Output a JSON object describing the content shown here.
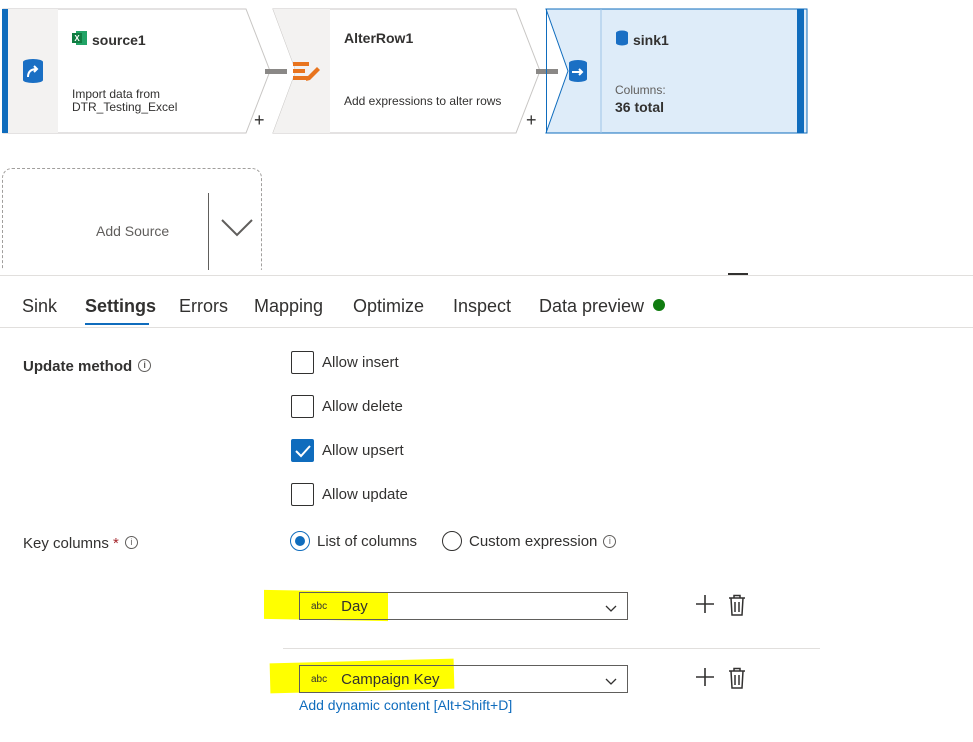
{
  "flow": {
    "nodes": [
      {
        "title": "source1",
        "desc_line1": "Import data from",
        "desc_line2": "DTR_Testing_Excel",
        "icon": "excel-icon"
      },
      {
        "title": "AlterRow1",
        "desc_line1": "Add expressions to alter rows",
        "icon": "alter-row-icon"
      },
      {
        "title": "sink1",
        "desc_line1": "Columns:",
        "desc_line2": "36 total",
        "icon": "database-icon"
      }
    ],
    "plus": "+",
    "add_source": "Add Source"
  },
  "tabs": [
    {
      "label": "Sink"
    },
    {
      "label": "Settings",
      "active": true
    },
    {
      "label": "Errors"
    },
    {
      "label": "Mapping"
    },
    {
      "label": "Optimize"
    },
    {
      "label": "Inspect"
    },
    {
      "label": "Data preview",
      "status_color": "#107c10"
    }
  ],
  "settings": {
    "update_method_label": "Update method",
    "info_glyph": "i",
    "checkboxes": [
      {
        "label": "Allow insert",
        "checked": false
      },
      {
        "label": "Allow delete",
        "checked": false
      },
      {
        "label": "Allow upsert",
        "checked": true
      },
      {
        "label": "Allow update",
        "checked": false
      }
    ],
    "key_columns_label": "Key columns",
    "required_marker": "*",
    "key_mode_options": [
      {
        "label": "List of columns",
        "selected": true
      },
      {
        "label": "Custom expression",
        "selected": false
      }
    ],
    "key_columns": [
      {
        "type": "abc",
        "value": "Day"
      },
      {
        "type": "abc",
        "value": "Campaign Key"
      }
    ],
    "dynamic_content_link": "Add dynamic content [Alt+Shift+D]"
  },
  "colors": {
    "accent": "#0f6cbd",
    "highlight": "#ffff00",
    "selected_node": "#deecf9"
  }
}
